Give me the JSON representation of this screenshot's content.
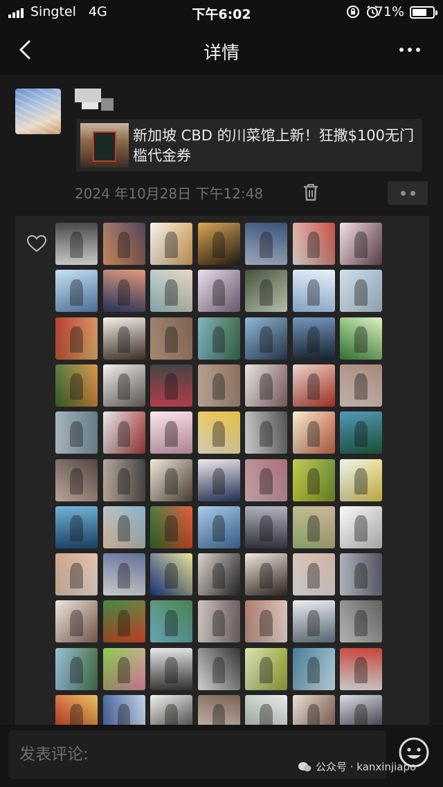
{
  "status_bar": {
    "carrier": "Singtel",
    "network": "4G",
    "time": "下午6:02",
    "battery": "71%",
    "battery_level": 0.71,
    "icons": [
      "signal-icon",
      "rotation-lock-icon",
      "alarm-icon",
      "battery-icon"
    ]
  },
  "nav": {
    "title": "详情",
    "back_icon": "chevron-left-icon",
    "more_icon": "more-icon"
  },
  "post": {
    "share_title": "新加坡 CBD 的川菜馆上新！狂撒$100无门槛代金券",
    "timestamp": "2024 年10月28日  下午12:48",
    "delete_icon": "trash-icon",
    "comment_icon": "more-dots-icon"
  },
  "likes": {
    "icon": "heart-outline-icon",
    "avatars": [
      {
        "c1": "#f2f2f2",
        "c2": "#2e2e2e"
      },
      {
        "c1": "#f0a06a",
        "c2": "#3a2a44"
      },
      {
        "c1": "#f7f1e8",
        "c2": "#d9a760"
      },
      {
        "c1": "#d79a3a",
        "c2": "#2a2118"
      },
      {
        "c1": "#bccbe2",
        "c2": "#1e3a66"
      },
      {
        "c1": "#f1ede8",
        "c2": "#c0392b"
      },
      {
        "c1": "#f4dbe2",
        "c2": "#6a4a55"
      },
      {
        "c1": "#bfe0f5",
        "c2": "#5a86b5"
      },
      {
        "c1": "#2f3f6e",
        "c2": "#e08a6a"
      },
      {
        "c1": "#9bc6c9",
        "c2": "#e6d0b8"
      },
      {
        "c1": "#eadbea",
        "c2": "#7c6a84"
      },
      {
        "c1": "#2b3a20",
        "c2": "#d8e6cf"
      },
      {
        "c1": "#9ec6f1",
        "c2": "#e7eef7"
      },
      {
        "c1": "#d8ebf6",
        "c2": "#9db3c7"
      },
      {
        "c1": "#b3261e",
        "c2": "#e5b66a"
      },
      {
        "c1": "#f4eee6",
        "c2": "#4a3a30"
      },
      {
        "c1": "#c9a48a",
        "c2": "#6b4c3b"
      },
      {
        "c1": "#7fb9c9",
        "c2": "#2f5f3a"
      },
      {
        "c1": "#7fb0d6",
        "c2": "#2f3f55"
      },
      {
        "c1": "#5f86b5",
        "c2": "#1e2a3a"
      },
      {
        "c1": "#3a8a3a",
        "c2": "#d8f0b8"
      },
      {
        "c1": "#3c6b2a",
        "c2": "#d9893a"
      },
      {
        "c1": "#f3f0ea",
        "c2": "#6c6660"
      },
      {
        "c1": "#d94a5a",
        "c2": "#2a2a2a"
      },
      {
        "c1": "#d9c3b1",
        "c2": "#7a5c48"
      },
      {
        "c1": "#e8e0e0",
        "c2": "#8a6a6a"
      },
      {
        "c1": "#e6cfc6",
        "c2": "#c0392b"
      },
      {
        "c1": "#e9d6cc",
        "c2": "#9a7a6a"
      },
      {
        "c1": "#c9d8e0",
        "c2": "#4e6a7a"
      },
      {
        "c1": "#e6e6e6",
        "c2": "#a83a3a"
      },
      {
        "c1": "#fbe6ec",
        "c2": "#d49ab0"
      },
      {
        "c1": "#fff4d6",
        "c2": "#e0b62a"
      },
      {
        "c1": "#f2f2f2",
        "c2": "#3a3a3a"
      },
      {
        "c1": "#f6e9c9",
        "c2": "#c8664a"
      },
      {
        "c1": "#3a8ab3",
        "c2": "#1f5f3f"
      },
      {
        "c1": "#e0c6b8",
        "c2": "#3a2a24"
      },
      {
        "c1": "#d4c0b0",
        "c2": "#2a2a2a"
      },
      {
        "c1": "#efe6d8",
        "c2": "#5a4a3a"
      },
      {
        "c1": "#f1e6e6",
        "c2": "#2a3a6a"
      },
      {
        "c1": "#e6c0c6",
        "c2": "#9a5a66"
      },
      {
        "c1": "#c8d23a",
        "c2": "#6a8a2a"
      },
      {
        "c1": "#e8f4f0",
        "c2": "#e6c84a"
      },
      {
        "c1": "#5fa8d3",
        "c2": "#1f4e79"
      },
      {
        "c1": "#f0d2b0",
        "c2": "#7aa7c7"
      },
      {
        "c1": "#2f6f2a",
        "c2": "#e04a2a"
      },
      {
        "c1": "#9fc6e6",
        "c2": "#3f6f9f"
      },
      {
        "c1": "#3a3a4a",
        "c2": "#a8a8b8"
      },
      {
        "c1": "#a3c27a",
        "c2": "#c8a68a"
      },
      {
        "c1": "#fafafa",
        "c2": "#c8c8c8"
      },
      {
        "c1": "#c99a7a",
        "c2": "#f3e6da"
      },
      {
        "c1": "#f4f4f4",
        "c2": "#4a5a8a"
      },
      {
        "c1": "#1a3a8a",
        "c2": "#e6e08a"
      },
      {
        "c1": "#d8d0c8",
        "c2": "#2a2a2a"
      },
      {
        "c1": "#efe6dc",
        "c2": "#3a2a24"
      },
      {
        "c1": "#f2f2f2",
        "c2": "#c8a898"
      },
      {
        "c1": "#cfd8e0",
        "c2": "#3a3a4a"
      },
      {
        "c1": "#f0e2dc",
        "c2": "#8a6a5a"
      },
      {
        "c1": "#2a7a2a",
        "c2": "#e64a2a"
      },
      {
        "c1": "#7ac6d8",
        "c2": "#2f6f3a"
      },
      {
        "c1": "#e8e0da",
        "c2": "#5a4a4a"
      },
      {
        "c1": "#a86a5a",
        "c2": "#f2e6de"
      },
      {
        "c1": "#e8ecef",
        "c2": "#6a7a8a"
      },
      {
        "c1": "#d8d8d8",
        "c2": "#4a4a4a"
      },
      {
        "c1": "#9ac6e6",
        "c2": "#3a6a3a"
      },
      {
        "c1": "#7ac63a",
        "c2": "#f08ab0"
      },
      {
        "c1": "#e8e8e8",
        "c2": "#3a3a3a"
      },
      {
        "c1": "#fafafa",
        "c2": "#1a1a1a"
      },
      {
        "c1": "#d8e0a8",
        "c2": "#9aa83a"
      },
      {
        "c1": "#2a6a8a",
        "c2": "#d8f0f8"
      },
      {
        "c1": "#f2f2f2",
        "c2": "#c0281e"
      },
      {
        "c1": "#c0281e",
        "c2": "#e6b84a"
      },
      {
        "c1": "#3a5a9a",
        "c2": "#c8d8f0"
      },
      {
        "c1": "#f2f0ec",
        "c2": "#3a3a3a"
      },
      {
        "c1": "#f4ece0",
        "c2": "#6a4a3a"
      },
      {
        "c1": "#a8b8a8",
        "c2": "#e8e8e8"
      },
      {
        "c1": "#e8dcd0",
        "c2": "#7a5a4a"
      },
      {
        "c1": "#d8d8e0",
        "c2": "#2a2a3a"
      }
    ]
  },
  "comment_bar": {
    "placeholder": "发表评论:",
    "emoji_icon": "emoji-icon"
  },
  "watermark": {
    "text": "公众号 · kanxinjiapo",
    "icon": "wechat-official-icon"
  }
}
